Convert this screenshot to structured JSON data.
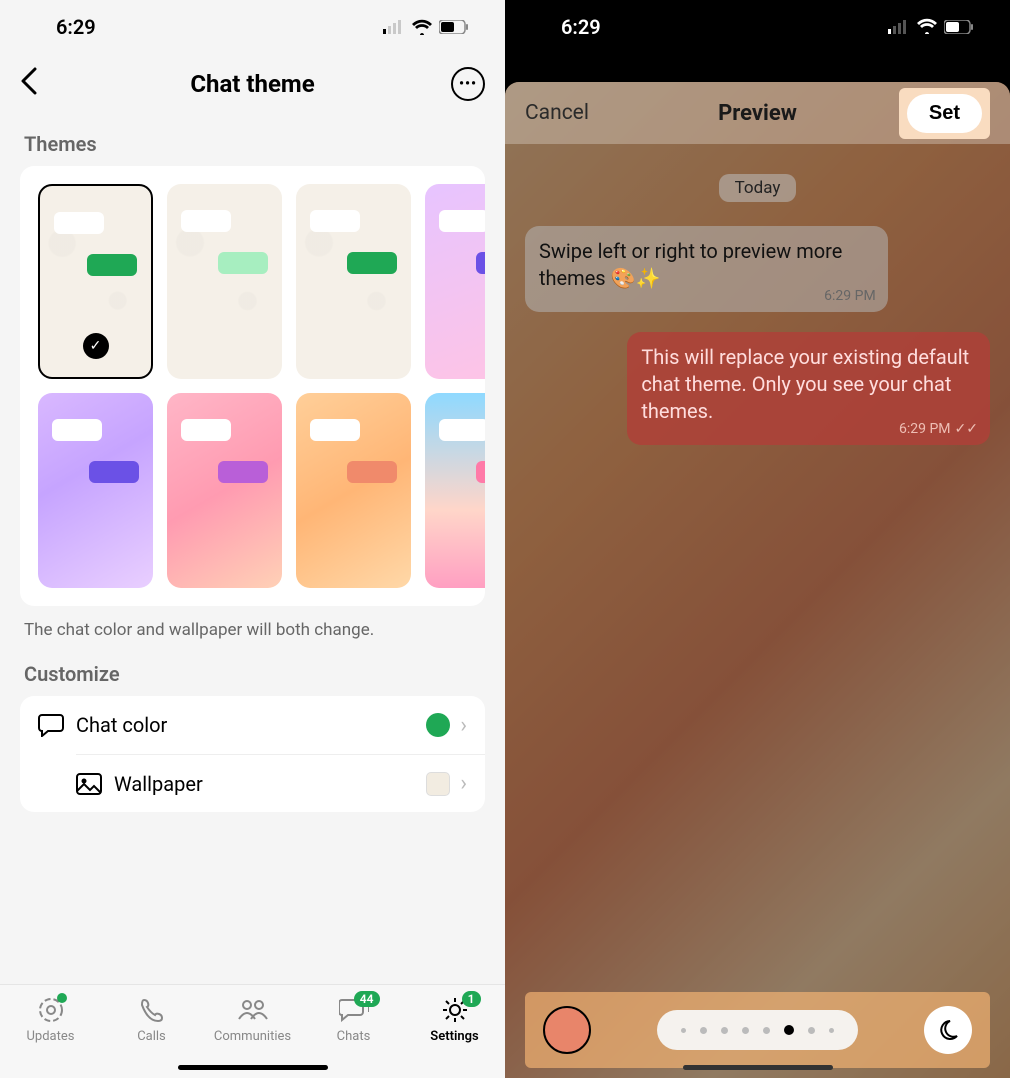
{
  "left": {
    "status_time": "6:29",
    "nav_title": "Chat theme",
    "themes_header": "Themes",
    "themes_note": "The chat color and wallpaper will both change.",
    "customize_header": "Customize",
    "customize": {
      "chat_color_label": "Chat color",
      "chat_color_value": "#1fa855",
      "wallpaper_label": "Wallpaper",
      "wallpaper_swatch": "#f2ece1"
    },
    "theme_thumbs": [
      {
        "bg": "wa-pattern",
        "out": "#1fa855",
        "selected": true
      },
      {
        "bg": "wa-pattern",
        "out": "#a7eec0",
        "selected": false
      },
      {
        "bg": "wa-pattern",
        "out": "#1fa855",
        "selected": false
      },
      {
        "bg": "linear-gradient(160deg,#e7c4ff,#ffc4e4)",
        "out": "#6b51e6",
        "selected": false
      },
      {
        "bg": "linear-gradient(150deg,#d9b8ff 0%,#c6a4ff 40%,#e9cfff 100%)",
        "out": "#6b51e6",
        "selected": false
      },
      {
        "bg": "linear-gradient(150deg,#ffb6c7 0%,#ff9bb1 50%,#ffd1b6 100%)",
        "out": "#b95fd8",
        "selected": false
      },
      {
        "bg": "linear-gradient(150deg,#ffcf99 0%,#ffb676 50%,#ffd8a8 100%)",
        "out": "#f08a6b",
        "selected": false
      },
      {
        "bg": "linear-gradient(180deg,#8fd9ff 0%,#ffd6c9 60%,#ff9fc2 100%)",
        "out": "#ff7aa8",
        "selected": false
      }
    ],
    "tabs": {
      "updates": "Updates",
      "calls": "Calls",
      "communities": "Communities",
      "chats": "Chats",
      "chats_badge": "44",
      "settings": "Settings",
      "settings_badge": "1"
    }
  },
  "right": {
    "status_time": "6:29",
    "cancel": "Cancel",
    "preview_title": "Preview",
    "set": "Set",
    "date_label": "Today",
    "msg_in": "Swipe left or right to preview more themes 🎨✨",
    "msg_in_time": "6:29 PM",
    "msg_out": "This will replace your existing default chat theme. Only you see your chat themes.",
    "msg_out_time": "6:29 PM",
    "pager_total": 8,
    "pager_active_index": 5,
    "accent_color": "#e8856a"
  }
}
